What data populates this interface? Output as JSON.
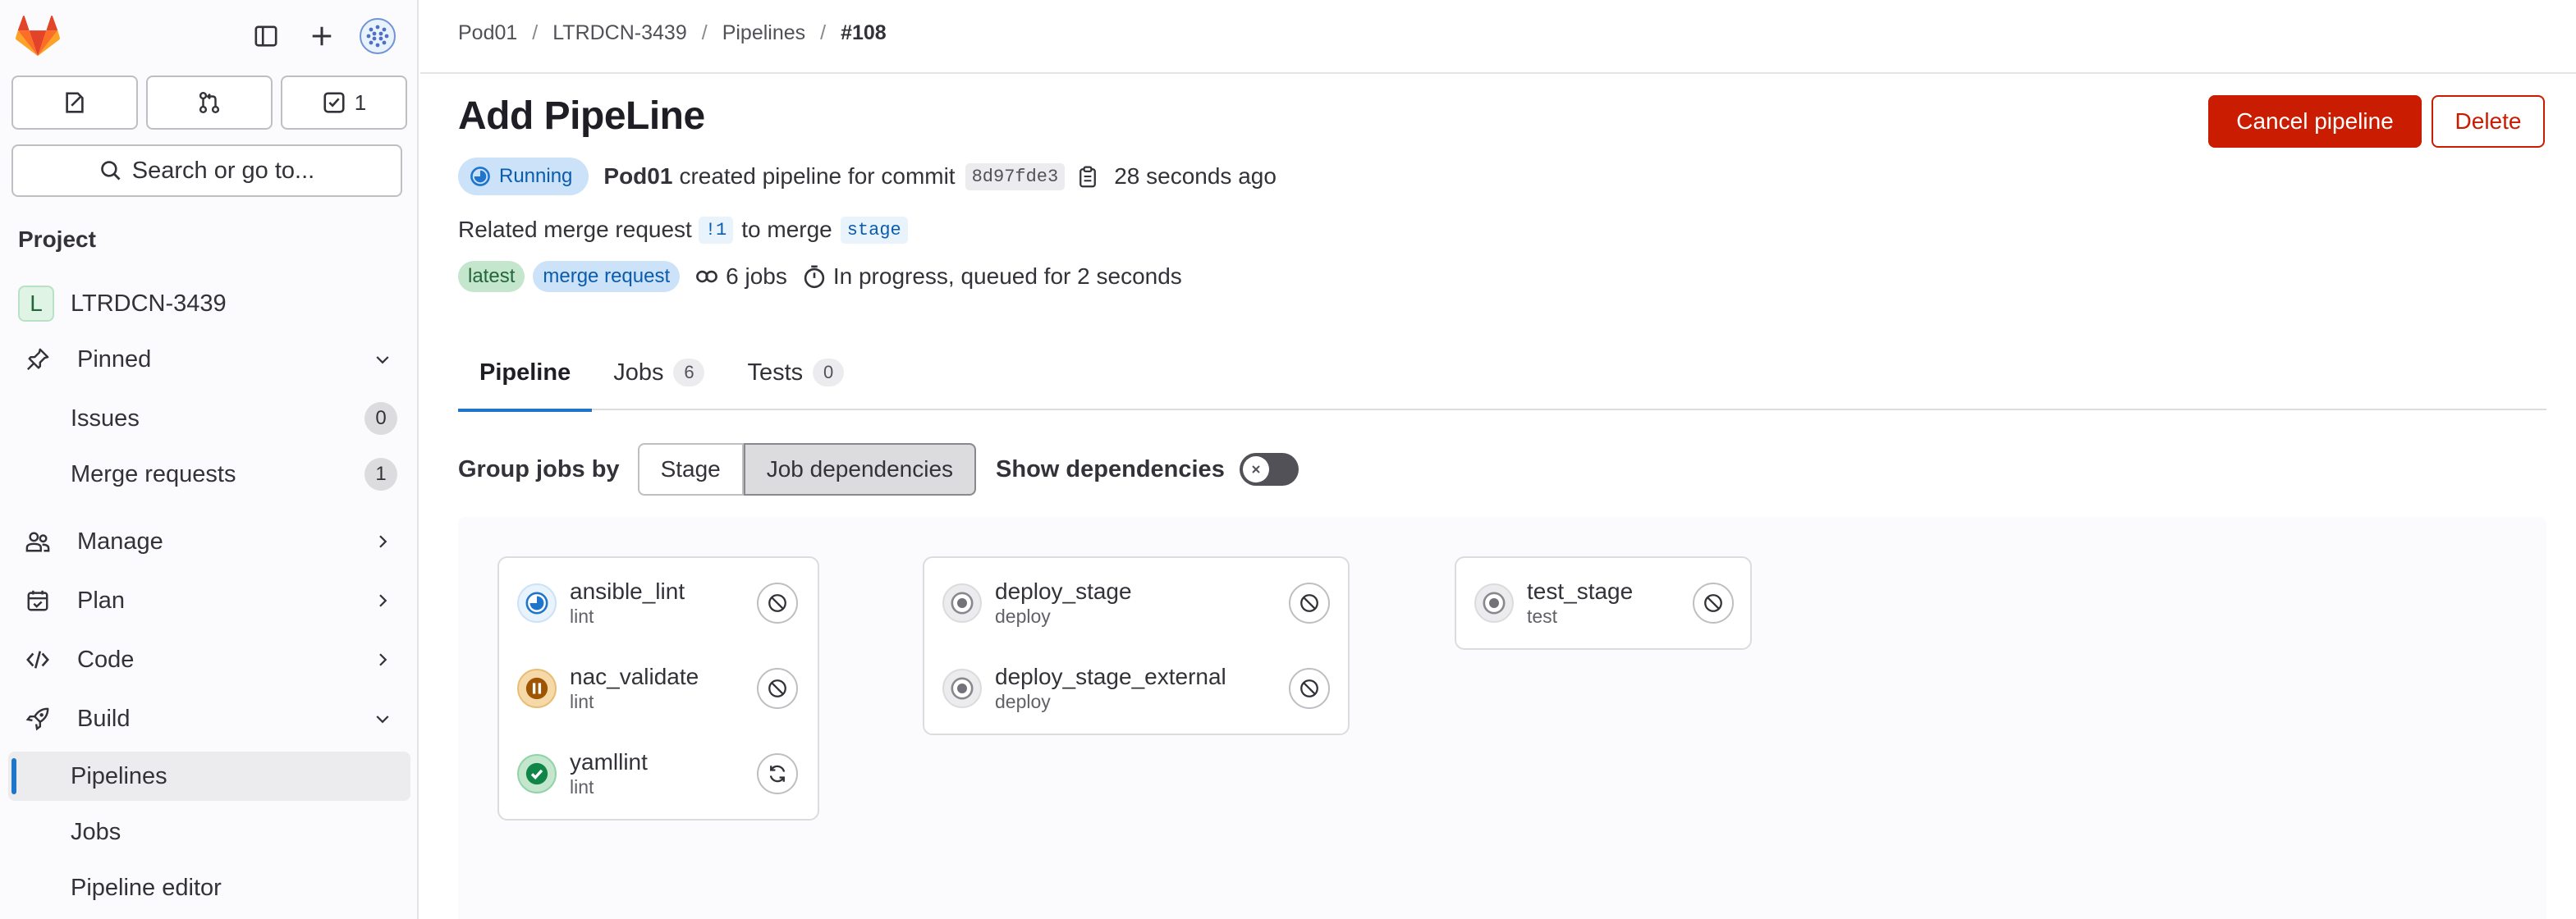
{
  "sidebar": {
    "todo_count": "1",
    "search_label": "Search or go to...",
    "section_title": "Project",
    "project_initial": "L",
    "project_name": "LTRDCN-3439",
    "pinned_label": "Pinned",
    "issues_label": "Issues",
    "issues_count": "0",
    "mr_label": "Merge requests",
    "mr_count": "1",
    "manage_label": "Manage",
    "plan_label": "Plan",
    "code_label": "Code",
    "build_label": "Build",
    "pipelines_label": "Pipelines",
    "jobs_label": "Jobs",
    "pipeline_editor_label": "Pipeline editor"
  },
  "breadcrumb": {
    "group": "Pod01",
    "project": "LTRDCN-3439",
    "section": "Pipelines",
    "current": "#108"
  },
  "header": {
    "title": "Add PipeLine",
    "cancel_label": "Cancel pipeline",
    "delete_label": "Delete",
    "status_label": "Running",
    "author": "Pod01",
    "created_text": "created pipeline for commit",
    "commit_sha": "8d97fde3",
    "time_ago": "28 seconds ago",
    "related_text": "Related merge request",
    "mr_ref": "!1",
    "to_merge_text": "to merge",
    "branch": "stage",
    "badge_latest": "latest",
    "badge_mr": "merge request",
    "jobs_text": "6 jobs",
    "progress_text": "In progress, queued for 2 seconds"
  },
  "tabs": [
    {
      "label": "Pipeline",
      "count": ""
    },
    {
      "label": "Jobs",
      "count": "6"
    },
    {
      "label": "Tests",
      "count": "0"
    }
  ],
  "group_by": {
    "label": "Group jobs by",
    "options": [
      "Stage",
      "Job dependencies"
    ],
    "selected": "Job dependencies",
    "show_dependencies_label": "Show dependencies",
    "show_dependencies": false
  },
  "graph": {
    "columns": [
      {
        "jobs": [
          {
            "name": "ansible_lint",
            "stage": "lint",
            "status": "running",
            "action": "cancel"
          },
          {
            "name": "nac_validate",
            "stage": "lint",
            "status": "manual",
            "action": "cancel"
          },
          {
            "name": "yamllint",
            "stage": "lint",
            "status": "success",
            "action": "retry"
          }
        ]
      },
      {
        "jobs": [
          {
            "name": "deploy_stage",
            "stage": "deploy",
            "status": "created",
            "action": "cancel"
          },
          {
            "name": "deploy_stage_external",
            "stage": "deploy",
            "status": "created",
            "action": "cancel"
          }
        ]
      },
      {
        "jobs": [
          {
            "name": "test_stage",
            "stage": "test",
            "status": "created",
            "action": "cancel"
          }
        ]
      }
    ]
  },
  "colors": {
    "brand_orange": "#fc6d26",
    "danger": "#c91c00",
    "link_blue": "#1f75cb",
    "running_bg": "#cbe2f9",
    "success_green": "#108548",
    "manual_brown": "#9e5400"
  }
}
